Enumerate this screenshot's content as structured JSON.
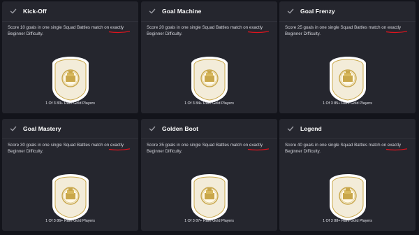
{
  "objectives": [
    {
      "title": "Kick-Off",
      "description_before": "Score 10 goals in one single Squad Battles match on ",
      "highlight": "exactly",
      "description_after": " Beginner Difficulty.",
      "reward": "1 Of 3 83+ Rare Gold Players"
    },
    {
      "title": "Goal Machine",
      "description_before": "Score 20 goals in one single Squad Battles match on ",
      "highlight": "exactly",
      "description_after": " Beginner Difficulty.",
      "reward": "1 Of 3 84+ Rare Gold Players"
    },
    {
      "title": "Goal Frenzy",
      "description_before": "Score 25 goals in one single Squad Battles match on ",
      "highlight": "exactly",
      "description_after": " Beginner Difficulty.",
      "reward": "1 Of 3 85+ Rare Gold Players"
    },
    {
      "title": "Goal Mastery",
      "description_before": "Score 30 goals in one single Squad Battles match on ",
      "highlight": "exactly",
      "description_after": " Beginner Difficulty.",
      "reward": "1 Of 3 86+ Rare Gold Players"
    },
    {
      "title": "Golden Boot",
      "description_before": "Score 35 goals in one single Squad Battles match on ",
      "highlight": "exactly",
      "description_after": " Beginner Difficulty.",
      "reward": "1 Of 3 87+ Rare Gold Players"
    },
    {
      "title": "Legend",
      "description_before": "Score 40 goals in one single Squad Battles match on ",
      "highlight": "exactly",
      "description_after": " Beginner Difficulty.",
      "reward": "1 Of 3 88+ Rare Gold Players"
    }
  ],
  "colors": {
    "background": "#13141b",
    "card": "#25262e",
    "underline": "#e0141e",
    "gold": "#c9a74a"
  },
  "icons": {
    "check": "check-icon",
    "pack": "gold-pack-icon"
  }
}
